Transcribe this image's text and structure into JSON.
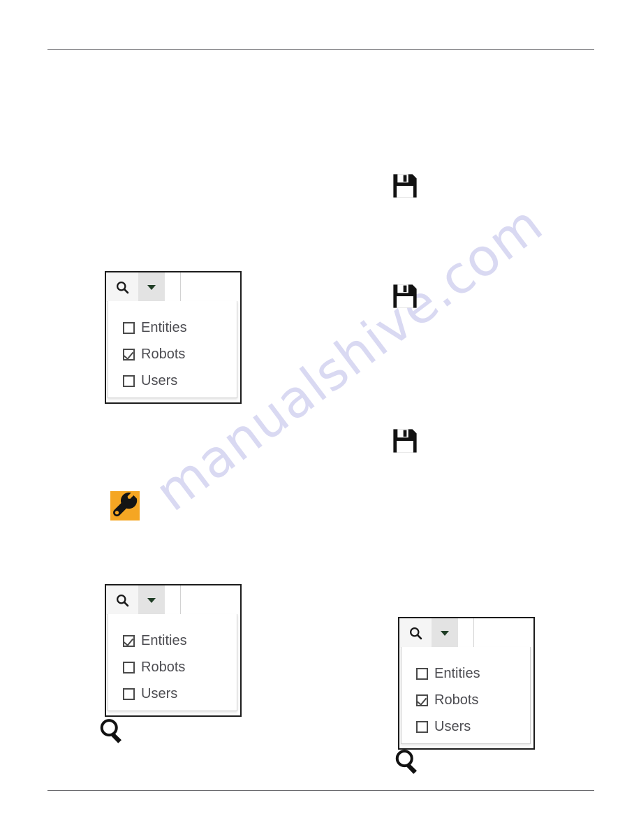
{
  "page": {
    "background_color": "#ffffff",
    "rule_color": "#6a6a6e",
    "watermark": "manualshive.com",
    "watermark_color": "#d9d9f2"
  },
  "icons": {
    "search": "search-icon",
    "caret": "chevron-down-icon",
    "save": "save-floppy-icon",
    "wrench": "wrench-tool-icon",
    "magnifier": "magnifier-icon"
  },
  "widgets": [
    {
      "id": "search-dropdown-1",
      "options": [
        {
          "label": "Entities",
          "checked": false
        },
        {
          "label": "Robots",
          "checked": true
        },
        {
          "label": "Users",
          "checked": false
        }
      ]
    },
    {
      "id": "search-dropdown-2",
      "options": [
        {
          "label": "Entities",
          "checked": true
        },
        {
          "label": "Robots",
          "checked": false
        },
        {
          "label": "Users",
          "checked": false
        }
      ]
    },
    {
      "id": "search-dropdown-3",
      "options": [
        {
          "label": "Entities",
          "checked": false
        },
        {
          "label": "Robots",
          "checked": true
        },
        {
          "label": "Users",
          "checked": false
        }
      ]
    }
  ]
}
